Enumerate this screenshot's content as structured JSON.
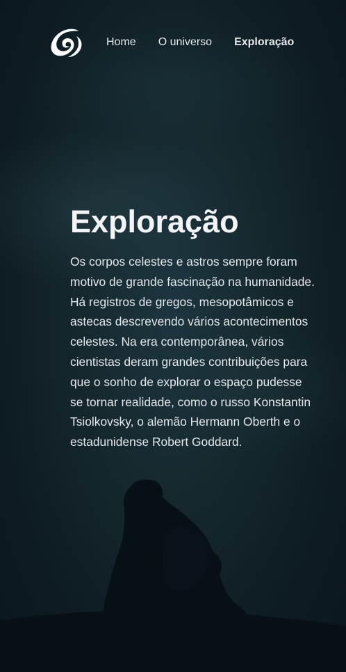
{
  "header": {
    "logo_icon": "swirl-galaxy-icon",
    "nav": {
      "home": "Home",
      "universe": "O universo",
      "exploration": "Exploração"
    }
  },
  "main": {
    "title": "Exploração",
    "paragraph": "Os corpos celestes e astros sempre foram motivo de grande fascinação na humanidade. Há registros de gregos, mesopotâmicos e astecas descrevendo vários acontecimentos celestes. Na era contemporânea, vários cientistas deram grandes contribuições para que o sonho de explorar o espaço pudesse se tornar realidade, como o russo Konstantin Tsiolkovsky, o alemão Hermann Oberth e o estadunidense Robert Goddard."
  },
  "colors": {
    "background": "#16292f",
    "text": "#e4e8ea",
    "silhouette": "#071015"
  }
}
